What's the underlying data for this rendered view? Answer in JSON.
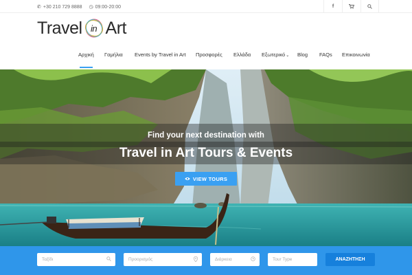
{
  "topbar": {
    "phone": "+30 210 729 8888",
    "hours": "09:00-20:00",
    "icons": [
      "phone-icon",
      "clock-icon",
      "facebook-icon",
      "cart-icon",
      "search-icon"
    ]
  },
  "logo": {
    "left": "Travel",
    "middle": "in",
    "right": "Art"
  },
  "nav": {
    "items": [
      {
        "label": "Αρχική"
      },
      {
        "label": "Γαμήλια"
      },
      {
        "label": "Events by Travel in Art"
      },
      {
        "label": "Προσφορές"
      },
      {
        "label": "Ελλάδα"
      },
      {
        "label": "Εξωτερικό",
        "caret": "⌄"
      },
      {
        "label": "Blog"
      },
      {
        "label": "FAQs"
      },
      {
        "label": "Επικοινωνία"
      }
    ],
    "active_index": 0
  },
  "hero": {
    "tagline": "Find your next destination with",
    "title": "Travel in Art Tours & Events",
    "button_label": "VIEW TOURS"
  },
  "search": {
    "destination_placeholder": "Ταξίδι",
    "location_placeholder": "Προορισμός",
    "duration_placeholder": "Διάρκεια",
    "type_placeholder": "Tour Type",
    "submit_label": "ΑΝΑΖΗΤΗΣΗ"
  },
  "colors": {
    "accent": "#3aa0f2",
    "search_bar": "#2f96ea",
    "search_button": "#1680dc"
  }
}
